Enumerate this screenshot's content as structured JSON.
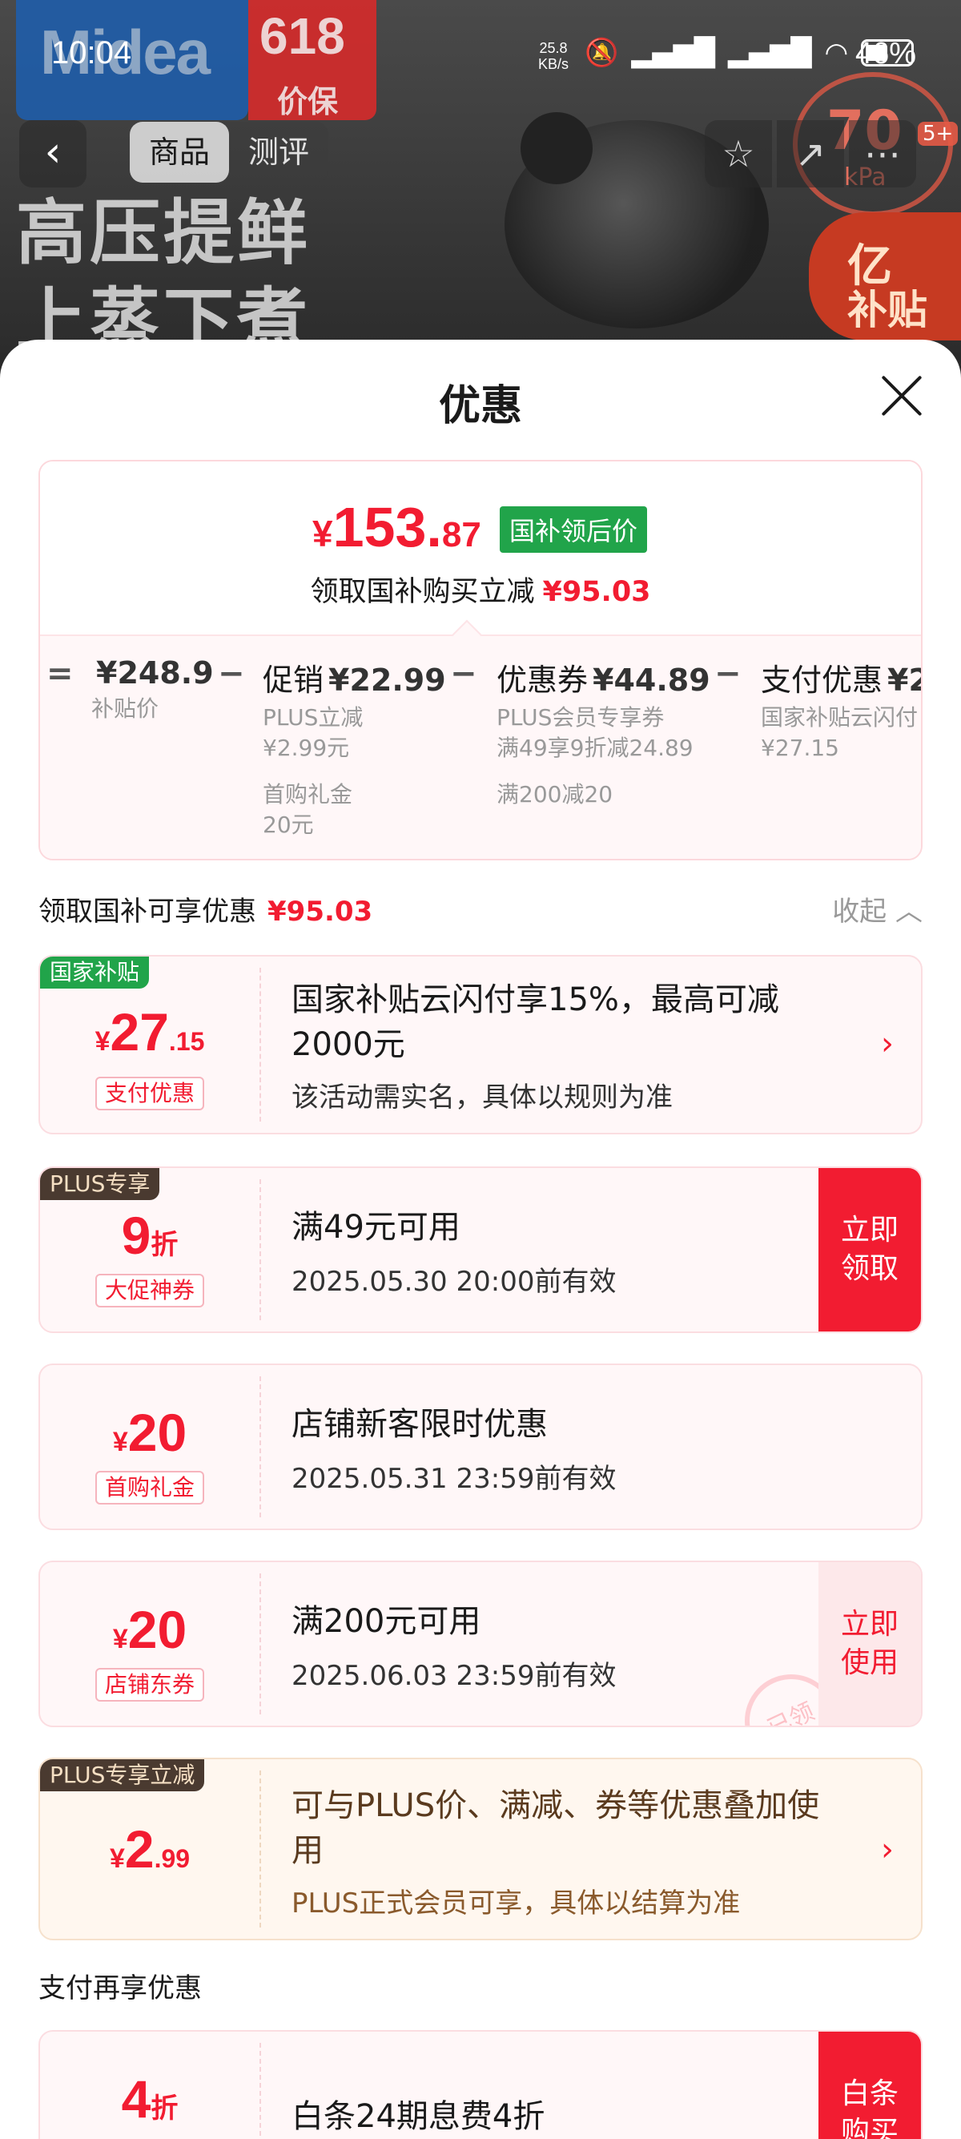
{
  "status_bar": {
    "time": "10:04",
    "speed": "25.8",
    "speed_unit": "KB/s",
    "battery": "46%"
  },
  "hero": {
    "brand": "Midea",
    "promo_number": "618",
    "promo_text": "价保",
    "slogan_line1": "高压提鲜",
    "slogan_line2": "上蒸下煮",
    "kpa_value": "70",
    "kpa_unit": "kPa",
    "kpa_badge": "5+",
    "subsidy_line1": "亿",
    "subsidy_line2": "补贴"
  },
  "nav": {
    "back": "‹",
    "tabs": [
      "商品",
      "测评"
    ]
  },
  "sheet": {
    "title": "优惠",
    "summary": {
      "currency": "¥",
      "price_int": "153.",
      "price_dec": "87",
      "tag": "国补领后价",
      "line_text": "领取国补购买立减",
      "line_amount": "¥95.03"
    },
    "calc": {
      "eq": "=",
      "minus": "−",
      "cols": [
        {
          "label": "",
          "amount": "¥248.9",
          "sub1": "补贴价",
          "sub2": "",
          "sub3": "",
          "sub4": ""
        },
        {
          "label": "促销",
          "amount": "¥22.99",
          "sub1": "PLUS立减",
          "sub2": "¥2.99元",
          "sub3": "首购礼金",
          "sub4": "20元"
        },
        {
          "label": "优惠券",
          "amount": "¥44.89",
          "sub1": "PLUS会员专享券",
          "sub2": "满49享9折减24.89",
          "sub3": "满200减20",
          "sub4": ""
        },
        {
          "label": "支付优惠",
          "amount": "¥2",
          "sub1": "国家补贴云闪付",
          "sub2": "¥27.15",
          "sub3": "",
          "sub4": ""
        }
      ]
    },
    "section1": {
      "label": "领取国补可享优惠",
      "amount": "¥95.03",
      "collapse": "收起"
    },
    "offers": [
      {
        "badge": "国家补贴",
        "cur": "¥",
        "int": "27",
        "dec": ".15",
        "pill": "支付优惠",
        "title_line1": "国家补贴云闪付享15%，最高可减",
        "title_line2": "2000元",
        "sub": "该活动需实名，具体以规则为准"
      },
      {
        "badge": "PLUS专享",
        "int": "9",
        "suffix": "折",
        "pill": "大促神券",
        "title_line1": "满49元可用",
        "sub": "2025.05.30 20:00前有效",
        "cta_line1": "立即",
        "cta_line2": "领取"
      },
      {
        "cur": "¥",
        "int": "20",
        "pill": "首购礼金",
        "title_line1": "店铺新客限时优惠",
        "sub": "2025.05.31 23:59前有效"
      },
      {
        "cur": "¥",
        "int": "20",
        "pill": "店铺东券",
        "title_line1": "满200元可用",
        "sub": "2025.06.03 23:59前有效",
        "cta_line1": "立即",
        "cta_line2": "使用",
        "stamp": "已领"
      },
      {
        "badge": "PLUS专享立减",
        "cur": "¥",
        "int": "2",
        "dec": ".99",
        "title_line1": "可与PLUS价、满减、券等优惠叠加使",
        "title_line2": "用",
        "sub": "PLUS正式会员可享，具体以结算为准"
      }
    ],
    "section2": {
      "label": "支付再享优惠"
    },
    "pay_offer": {
      "int": "4",
      "suffix": "折",
      "title_line1": "白条24期息费4折",
      "cta_line1": "白条",
      "cta_line2": "购买"
    }
  },
  "colors": {
    "accent": "#f21c31",
    "green_tag": "#21a44a",
    "plus_badge": "#4a3a30"
  }
}
